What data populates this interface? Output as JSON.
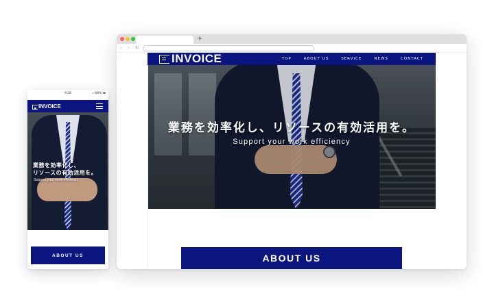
{
  "site": {
    "logo_text": "INVOICE",
    "nav": [
      "TOP",
      "ABOUT US",
      "SERVICE",
      "NEWS",
      "CONTACT"
    ],
    "hero_jp": "業務を効率化し、リソースの有効活用を。",
    "hero_jp_mobile_line1": "業務を効率化し、",
    "hero_jp_mobile_line2": "リソースの有効活用を。",
    "hero_en": "Support your work efficiency",
    "about_label": "ABOUT US"
  },
  "browser": {
    "new_tab_label": "+",
    "back_icon": "back-arrow-icon",
    "forward_icon": "forward-arrow-icon",
    "reload_icon": "reload-icon"
  },
  "phone": {
    "status_left": "",
    "status_time": "9:28",
    "status_right": "⁎ 68% ▬"
  },
  "colors": {
    "brand_navy": "#0b1580",
    "background": "#ffffff"
  }
}
